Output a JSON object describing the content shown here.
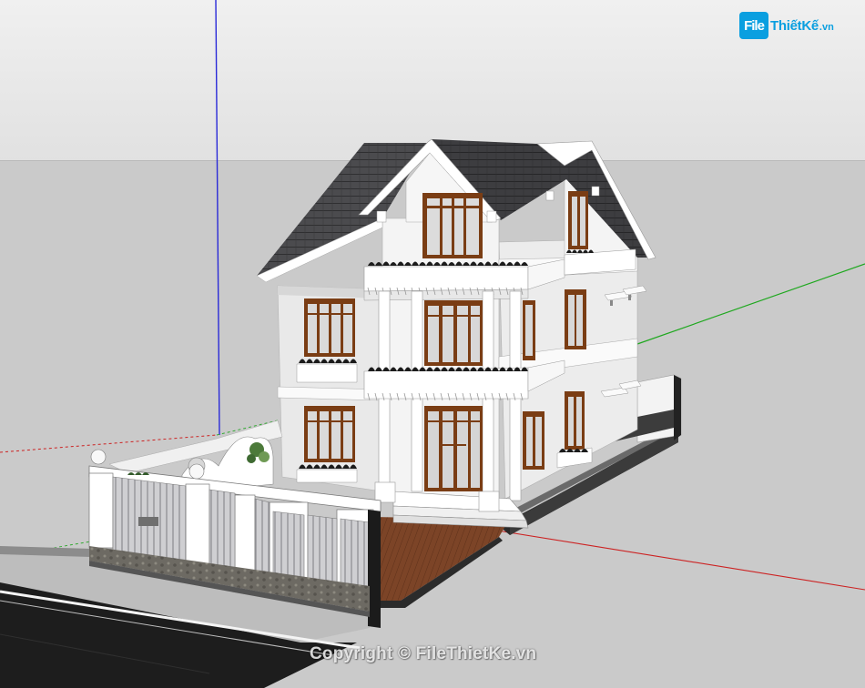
{
  "watermark": {
    "logo_mark": "File",
    "logo_word": "ThiếtKế",
    "logo_tld": ".vn",
    "copyright": "Copyright © FileThietKe.vn"
  },
  "viewport": {
    "sky_color": "#e6e6e6",
    "ground_color": "#c9c9c9",
    "axis_blue": "#2626d6",
    "axis_green": "#1ea31e",
    "axis_red": "#d42020",
    "roof_color": "#4a4a4d",
    "wall_color": "#f2f2f2",
    "window_frame_color": "#7a3e14",
    "driveway_color": "#7a4326",
    "road_color": "#1c1c1c"
  },
  "scene": {
    "model_icon": "house-3d-model"
  }
}
